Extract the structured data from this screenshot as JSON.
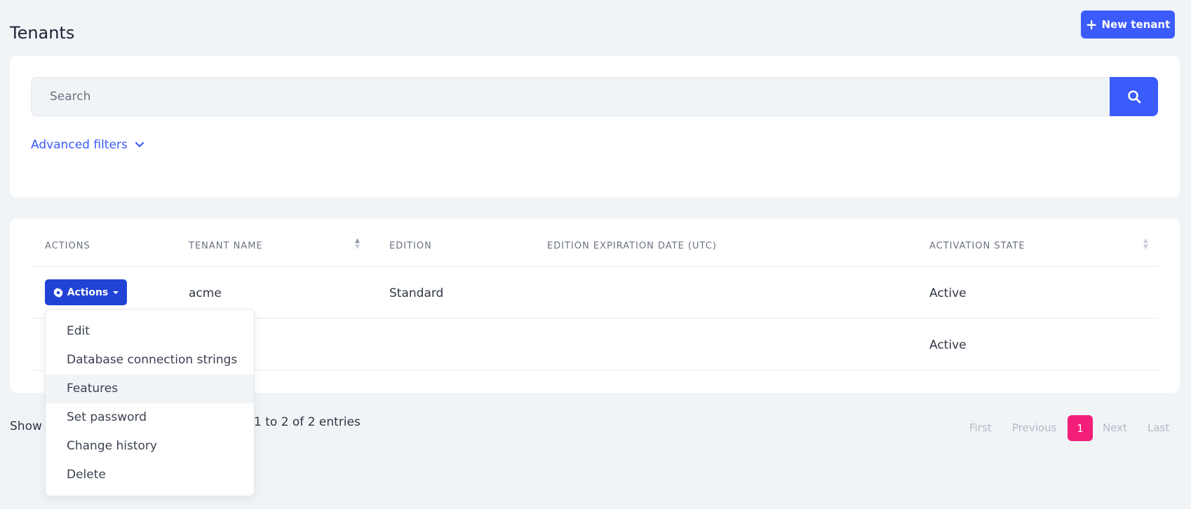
{
  "page": {
    "title": "Tenants",
    "new_button_label": "New tenant"
  },
  "colors": {
    "primary": "#3b5bfd",
    "actions_button": "#2043d6",
    "active_page": "#f21e7a",
    "background": "#f0f4f7"
  },
  "search": {
    "placeholder": "Search",
    "value": "",
    "button_icon": "search-icon"
  },
  "advanced_filters": {
    "label": "Advanced filters",
    "icon": "chevron-down-icon"
  },
  "table": {
    "columns": [
      "Actions",
      "Tenant name",
      "Edition",
      "Edition expiration date (UTC)",
      "Activation state"
    ],
    "rows": [
      {
        "tenant_name": "acme",
        "edition": "Standard",
        "expiration": "",
        "activation_state": "Active"
      },
      {
        "tenant_name": "",
        "edition": "",
        "expiration": "",
        "activation_state": "Active"
      }
    ],
    "actions_button_label": "Actions",
    "actions_icon": "gear-icon"
  },
  "actions_menu": {
    "items": [
      "Edit",
      "Database connection strings",
      "Features",
      "Set password",
      "Change history",
      "Delete"
    ],
    "highlighted": "Features"
  },
  "footer": {
    "show_label": "Show",
    "info": "1 to 2 of 2 entries"
  },
  "pagination": {
    "first": "First",
    "previous": "Previous",
    "current": "1",
    "next": "Next",
    "last": "Last"
  }
}
